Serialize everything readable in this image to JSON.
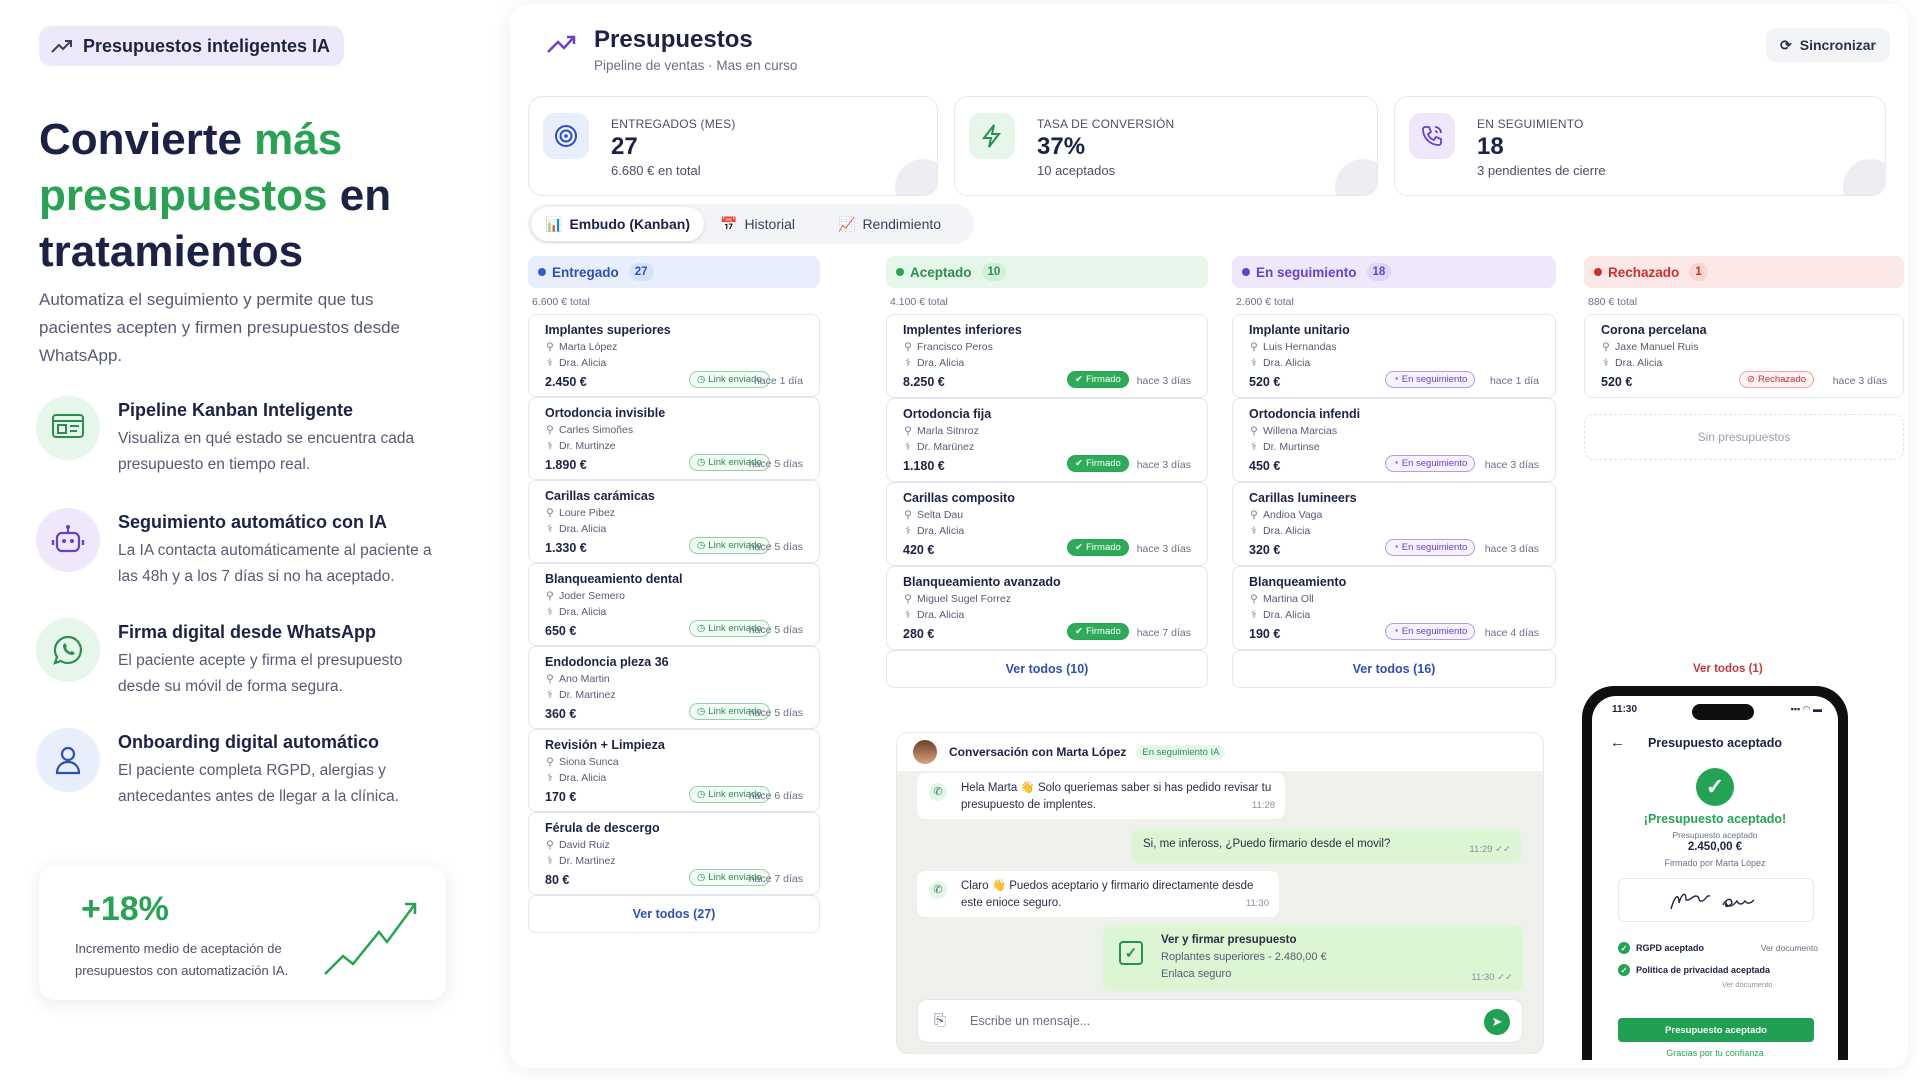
{
  "colors": {
    "accent_green": "#27a353",
    "accent_purple": "#6a3fd0",
    "accent_blue": "#2f4fb8",
    "accent_red": "#cc2f2f"
  },
  "promo": {
    "pill": "Presupuestos inteligentes IA",
    "headline_a": "Convierte ",
    "headline_b": "más presupuestos",
    "headline_c": " en tratamientos",
    "lead": "Automatiza el seguimiento y permite que tus pacientes acepten y firmen presupuestos desde WhatsApp.",
    "features": [
      {
        "icon": "kanban-icon",
        "title": "Pipeline Kanban Inteligente",
        "desc": "Visualiza en qué estado se encuentra cada presupuesto en tiempo real."
      },
      {
        "icon": "robot-icon",
        "title": "Seguimiento automático con IA",
        "desc": "La IA contacta automáticamente al paciente a las 48h y a los 7 días si no ha aceptado."
      },
      {
        "icon": "whatsapp-icon",
        "title": "Firma digital desde WhatsApp",
        "desc": "El paciente acepte y firma el presupuesto desde su móvil de forma segura."
      },
      {
        "icon": "user-icon",
        "title": "Onboarding digital automático",
        "desc": "El paciente completa RGPD, alergias y antecedantes antes de llegar a la clínica."
      }
    ],
    "stat": {
      "value": "+18%",
      "desc": "Incremento medio de aceptación de presupuestos con automatización IA."
    }
  },
  "app": {
    "title": "Presupuestos",
    "subtitle": "Pipeline de ventas · Mas en curso",
    "sync": "Sincronizar",
    "kpis": [
      {
        "label": "ENTREGADOS (MES)",
        "value": "27",
        "sub": "6.680 € en total",
        "icon": "target-icon"
      },
      {
        "label": "TASA DE CONVERSIÓN",
        "value": "37%",
        "sub": "10 aceptados",
        "icon": "bolt-icon"
      },
      {
        "label": "EN SEGUIMIENTO",
        "value": "18",
        "sub": "3 pendientes de cierre",
        "icon": "phone-call-icon"
      }
    ],
    "tabs": [
      {
        "label": "Embudo (Kanban)",
        "icon": "📊"
      },
      {
        "label": "Historial",
        "icon": "📅"
      },
      {
        "label": "Rendimiento",
        "icon": "📈"
      }
    ],
    "columns": [
      {
        "name": "Entregado",
        "count": "27",
        "total": "6.600 € total",
        "badge": "Link enviado",
        "more": "Ver todos (27)",
        "cards": [
          {
            "t": "Implantes superiores",
            "p": "Marta López",
            "d": "Dra. Alicia",
            "pr": "2.450 €",
            "tm": "hace 1 día"
          },
          {
            "t": "Ortodoncia invisible",
            "p": "Carles Simoñes",
            "d": "Dr. Murtinze",
            "pr": "1.890 €",
            "tm": "hace 5 días"
          },
          {
            "t": "Carillas carámicas",
            "p": "Loure Pibez",
            "d": "Dra. Alicia",
            "pr": "1.330 €",
            "tm": "hace 5 días"
          },
          {
            "t": "Blanqueamiento dental",
            "p": "Joder Semero",
            "d": "Dra. Alicia",
            "pr": "650 €",
            "tm": "hace 5 días"
          },
          {
            "t": "Endodoncia pleza 36",
            "p": "Ano Martin",
            "d": "Dr. Martinez",
            "pr": "360 €",
            "tm": "hace 5 días"
          },
          {
            "t": "Revisión + Limpieza",
            "p": "Siona Sunca",
            "d": "Dra. Alicia",
            "pr": "170 €",
            "tm": "hace 6 días"
          },
          {
            "t": "Férula de descergo",
            "p": "David Ruiz",
            "d": "Dr. Martinez",
            "pr": "80 €",
            "tm": "hace 7 días"
          }
        ]
      },
      {
        "name": "Aceptado",
        "count": "10",
        "total": "4.100 € total",
        "badge": "Firmado",
        "more": "Ver todos (10)",
        "cards": [
          {
            "t": "Implentes inferiores",
            "p": "Francisco Peros",
            "d": "Dra. Alicia",
            "pr": "8.250 €",
            "tm": "hace 3 días"
          },
          {
            "t": "Ortodoncia fija",
            "p": "Marla Sitnroz",
            "d": "Dr. Marünez",
            "pr": "1.180 €",
            "tm": "hace 3 días"
          },
          {
            "t": "Carillas composito",
            "p": "Selta Dau",
            "d": "Dra. Alicia",
            "pr": "420 €",
            "tm": "hace 3 días"
          },
          {
            "t": "Blanqueamiento avanzado",
            "p": "Miguel Sugel Forrez",
            "d": "Dra. Alicia",
            "pr": "280 €",
            "tm": "hace 7 días"
          }
        ]
      },
      {
        "name": "En seguimiento",
        "count": "18",
        "total": "2.600 € total",
        "badge": "En seguimiento",
        "more": "Ver todos (16)",
        "cards": [
          {
            "t": "Implante unitario",
            "p": "Luis Hernandas",
            "d": "Dra. Alicia",
            "pr": "520 €",
            "tm": "hace 1 día"
          },
          {
            "t": "Ortodoncia infendi",
            "p": "Willena Marcias",
            "d": "Dr. Murtinse",
            "pr": "450 €",
            "tm": "hace 3 días"
          },
          {
            "t": "Carillas lumineers",
            "p": "Andioa Vaga",
            "d": "Dra. Alicia",
            "pr": "320 €",
            "tm": "hace 3 días"
          },
          {
            "t": "Blanqueamiento",
            "p": "Martina Oll",
            "d": "Dra. Alicia",
            "pr": "190 €",
            "tm": "hace 4 días"
          }
        ]
      },
      {
        "name": "Rechazado",
        "count": "1",
        "total": "880 € total",
        "badge": "Rechazado",
        "more": "Ver todos (1)",
        "empty": "Sin presupuestos",
        "cards": [
          {
            "t": "Corona percelana",
            "p": "Jaxe Manuel Ruis",
            "d": "Dra. Alicia",
            "pr": "520 €",
            "tm": "hace 3 días"
          }
        ]
      }
    ],
    "chat": {
      "header": "Conversación con Marta López",
      "badge": "En seguimiento IA",
      "m1": "Hela Marta 👋 Solo queriemas saber si has pedido revisar tu presupuesto de implentes.",
      "m1t": "11:28",
      "m2": "Si, me infeross, ¿Puedo firmario desde el movil?",
      "m2t": "11:29",
      "m3": "Claro 👋 Puedos aceptario y firmario directamente desde este enioce seguro.",
      "m3t": "11:30",
      "card_title": "Ver y firmar presupuesto",
      "card_sub": "Roplantes superiores - 2.480,00 €",
      "card_link": "Enlaca seguro",
      "card_t": "11:30",
      "placeholder": "Escribe un mensaje..."
    },
    "phone": {
      "time": "11:30",
      "signal": "▪▪▪ ◠ ▬",
      "title": "Presupuesto aceptado",
      "ok": "¡Presupuesto aceptado!",
      "sub": "Presupuesto aceptado",
      "amount": "2.450,00 €",
      "by": "Firmado por Marta López",
      "signature": "Marta López",
      "r1": "RGPD aceptado",
      "r1l": "Ver documento",
      "r2": "Política de privacidad aceptada",
      "r2l": "Ver documento",
      "button": "Presupuesto aceptado",
      "thanks": "Gracias por tu confianza"
    }
  }
}
